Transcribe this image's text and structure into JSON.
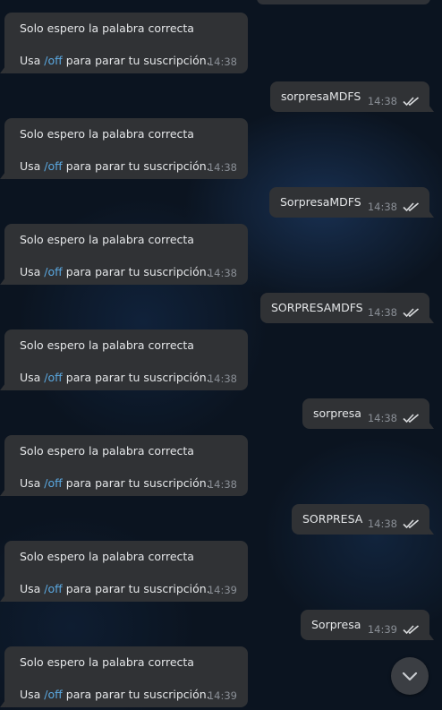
{
  "messages": {
    "incoming": {
      "line1": "Solo espero la palabra correcta",
      "line2_prefix": "Usa ",
      "command": "/off",
      "line2_suffix": " para parar tu suscripción."
    },
    "items": [
      {
        "direction": "incoming",
        "time": "14:38"
      },
      {
        "direction": "outgoing",
        "text": "sorpresaMDFS",
        "time": "14:38",
        "status": "read"
      },
      {
        "direction": "incoming",
        "time": "14:38"
      },
      {
        "direction": "outgoing",
        "text": "SorpresaMDFS",
        "time": "14:38",
        "status": "read"
      },
      {
        "direction": "incoming",
        "time": "14:38"
      },
      {
        "direction": "outgoing",
        "text": "SORPRESAMDFS",
        "time": "14:38",
        "status": "read"
      },
      {
        "direction": "incoming",
        "time": "14:38"
      },
      {
        "direction": "outgoing",
        "text": "sorpresa",
        "time": "14:38",
        "status": "read"
      },
      {
        "direction": "incoming",
        "time": "14:38"
      },
      {
        "direction": "outgoing",
        "text": "SORPRESA",
        "time": "14:38",
        "status": "read"
      },
      {
        "direction": "incoming",
        "time": "14:39"
      },
      {
        "direction": "outgoing",
        "text": "Sorpresa",
        "time": "14:39",
        "status": "read"
      },
      {
        "direction": "incoming",
        "time": "14:39"
      }
    ]
  },
  "icons": {
    "read_receipt": "double-check-icon",
    "scroll_down": "chevron-down-icon"
  },
  "colors": {
    "background": "#0b1420",
    "bubble": "#303235",
    "text": "#e4e6e8",
    "command_link": "#5aa8e0",
    "timestamp": "#8a8f96"
  }
}
